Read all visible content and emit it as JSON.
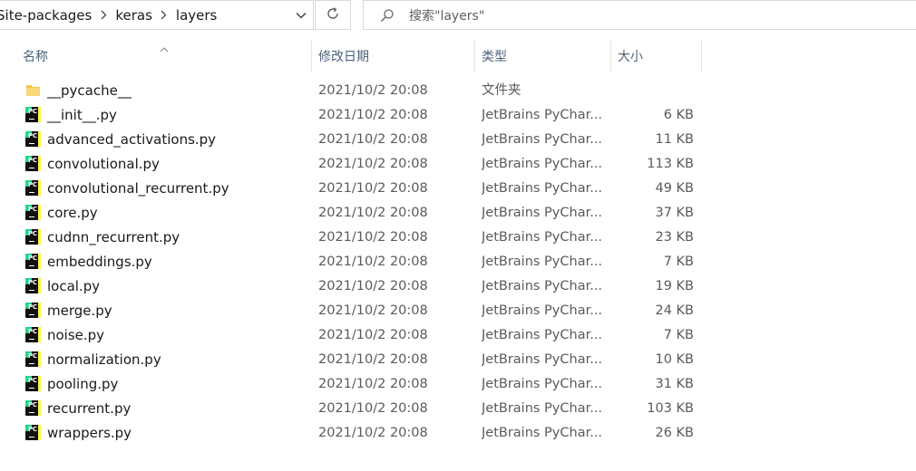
{
  "address_bar": {
    "crumbs": [
      "Site-packages",
      "keras",
      "layers"
    ]
  },
  "search": {
    "placeholder": "搜索\"layers\""
  },
  "columns": {
    "name": "名称",
    "date": "修改日期",
    "type": "类型",
    "size": "大小"
  },
  "icons": {
    "folder": "folder-icon",
    "py": "pycharm-file-icon",
    "refresh": "refresh-icon",
    "search": "search-icon",
    "dropdown": "chevron-down-icon",
    "separator": "chevron-right-icon"
  },
  "colors": {
    "folder": "#f4c542",
    "pycharm_green": "#21d789",
    "header_text": "#4c607a"
  },
  "files": [
    {
      "name": "__pycache__",
      "date": "2021/10/2 20:08",
      "type": "文件夹",
      "size": "",
      "kind": "folder"
    },
    {
      "name": "__init__.py",
      "date": "2021/10/2 20:08",
      "type": "JetBrains PyChar...",
      "size": "6 KB",
      "kind": "py"
    },
    {
      "name": "advanced_activations.py",
      "date": "2021/10/2 20:08",
      "type": "JetBrains PyChar...",
      "size": "11 KB",
      "kind": "py"
    },
    {
      "name": "convolutional.py",
      "date": "2021/10/2 20:08",
      "type": "JetBrains PyChar...",
      "size": "113 KB",
      "kind": "py"
    },
    {
      "name": "convolutional_recurrent.py",
      "date": "2021/10/2 20:08",
      "type": "JetBrains PyChar...",
      "size": "49 KB",
      "kind": "py"
    },
    {
      "name": "core.py",
      "date": "2021/10/2 20:08",
      "type": "JetBrains PyChar...",
      "size": "37 KB",
      "kind": "py"
    },
    {
      "name": "cudnn_recurrent.py",
      "date": "2021/10/2 20:08",
      "type": "JetBrains PyChar...",
      "size": "23 KB",
      "kind": "py"
    },
    {
      "name": "embeddings.py",
      "date": "2021/10/2 20:08",
      "type": "JetBrains PyChar...",
      "size": "7 KB",
      "kind": "py"
    },
    {
      "name": "local.py",
      "date": "2021/10/2 20:08",
      "type": "JetBrains PyChar...",
      "size": "19 KB",
      "kind": "py"
    },
    {
      "name": "merge.py",
      "date": "2021/10/2 20:08",
      "type": "JetBrains PyChar...",
      "size": "24 KB",
      "kind": "py"
    },
    {
      "name": "noise.py",
      "date": "2021/10/2 20:08",
      "type": "JetBrains PyChar...",
      "size": "7 KB",
      "kind": "py"
    },
    {
      "name": "normalization.py",
      "date": "2021/10/2 20:08",
      "type": "JetBrains PyChar...",
      "size": "10 KB",
      "kind": "py"
    },
    {
      "name": "pooling.py",
      "date": "2021/10/2 20:08",
      "type": "JetBrains PyChar...",
      "size": "31 KB",
      "kind": "py"
    },
    {
      "name": "recurrent.py",
      "date": "2021/10/2 20:08",
      "type": "JetBrains PyChar...",
      "size": "103 KB",
      "kind": "py"
    },
    {
      "name": "wrappers.py",
      "date": "2021/10/2 20:08",
      "type": "JetBrains PyChar...",
      "size": "26 KB",
      "kind": "py"
    }
  ]
}
